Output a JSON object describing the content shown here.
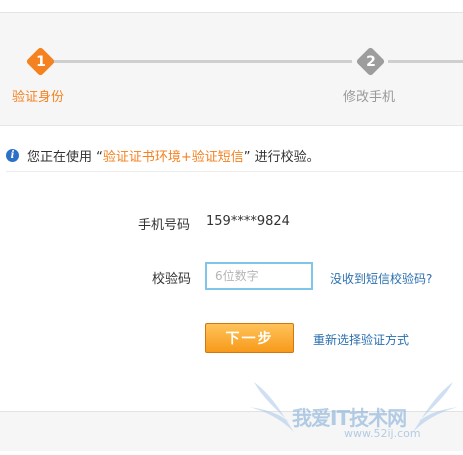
{
  "stepper": {
    "steps": [
      {
        "number": "1",
        "label": "验证身份",
        "state": "active"
      },
      {
        "number": "2",
        "label": "修改手机",
        "state": "inactive"
      }
    ]
  },
  "notice": {
    "prefix": "您正在使用 “",
    "highlight": "验证证书环境+验证短信",
    "suffix": "” 进行校验。"
  },
  "form": {
    "phone_label": "手机号码",
    "phone_value": "159****9824",
    "code_label": "校验码",
    "code_placeholder": "6位数字",
    "code_value": "",
    "no_code_link": "没收到短信校验码?",
    "next_button": "下一步",
    "reselect_link": "重新选择验证方式"
  },
  "watermark": {
    "title": "我爱IT技术网",
    "url": "www.52ij.com"
  },
  "colors": {
    "accent": "#f58220",
    "inactive": "#9d9d9d",
    "link": "#2a6fb0",
    "input_border": "#7fc6ea",
    "info": "#2d71c6"
  }
}
